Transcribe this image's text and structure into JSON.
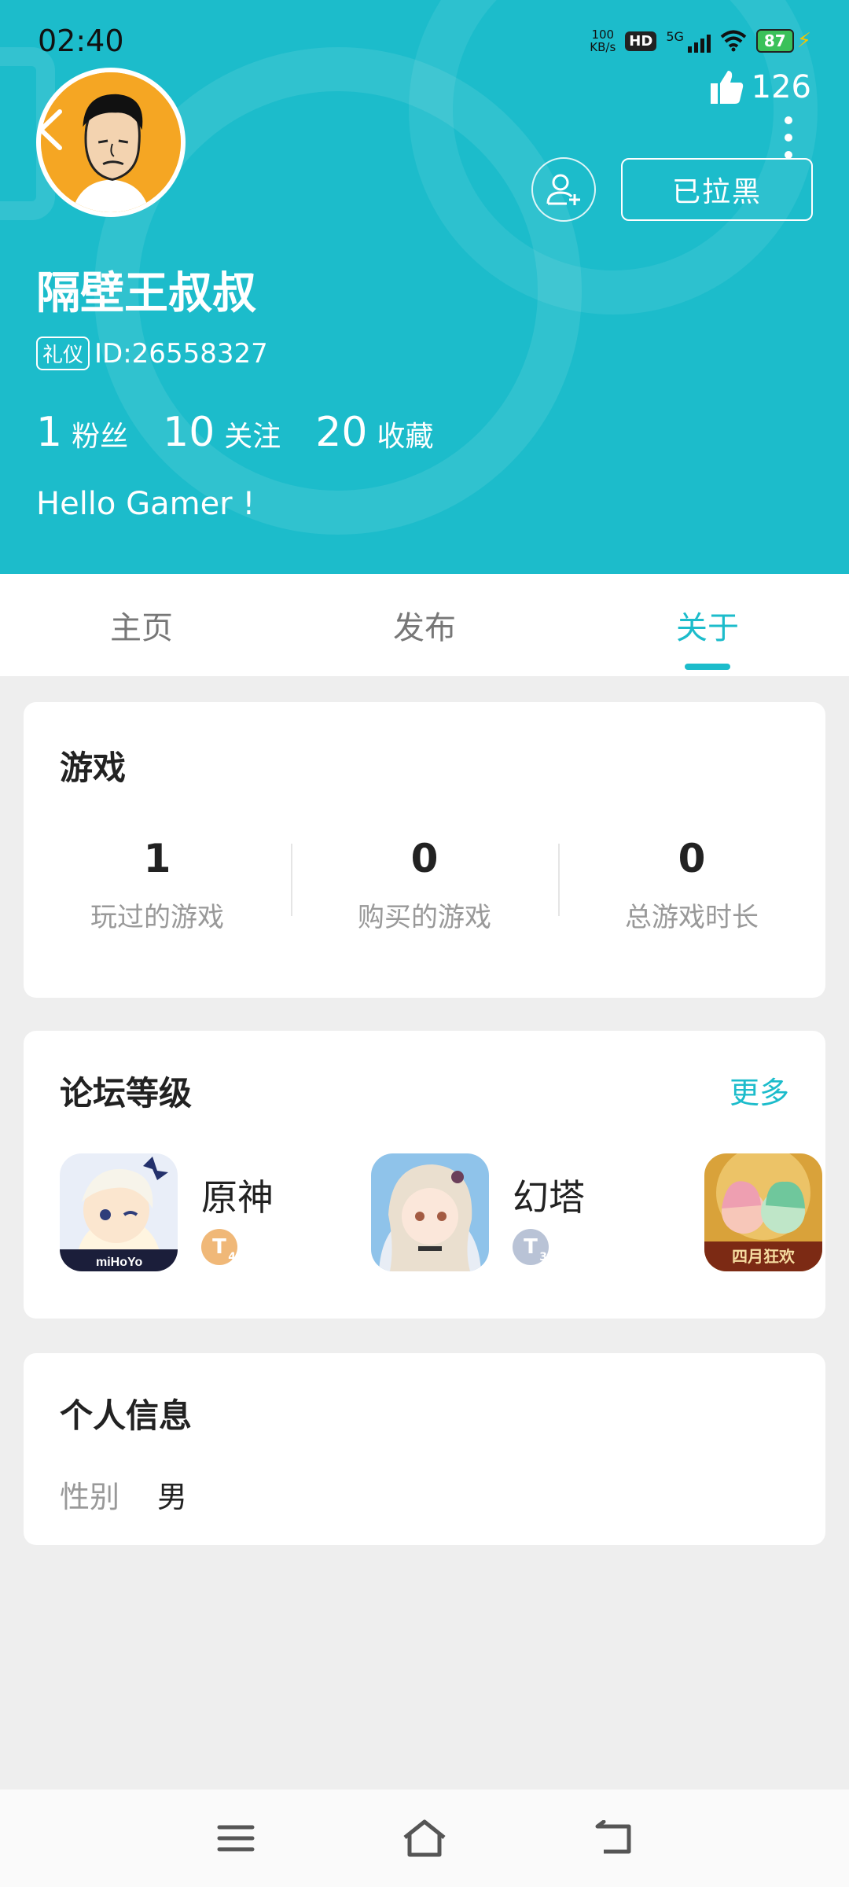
{
  "status_bar": {
    "time": "02:40",
    "net_speed_value": "100",
    "net_speed_unit": "KB/s",
    "hd": "HD",
    "network": "5G",
    "battery": "87"
  },
  "profile": {
    "likes": "126",
    "blocked_label": "已拉黑",
    "username": "隔壁王叔叔",
    "badge": "礼仪",
    "id_text": "ID:26558327",
    "fans_count": "1",
    "fans_label": "粉丝",
    "following_count": "10",
    "following_label": "关注",
    "favorites_count": "20",
    "favorites_label": "收藏",
    "bio": "Hello Gamer !"
  },
  "tabs": [
    {
      "label": "主页"
    },
    {
      "label": "发布"
    },
    {
      "label": "关于",
      "active": true
    }
  ],
  "games": {
    "title": "游戏",
    "stats": [
      {
        "value": "1",
        "label": "玩过的游戏"
      },
      {
        "value": "0",
        "label": "购买的游戏"
      },
      {
        "value": "0",
        "label": "总游戏时长"
      }
    ]
  },
  "forum": {
    "title": "论坛等级",
    "more": "更多",
    "items": [
      {
        "name": "原神",
        "level_letter": "T",
        "level_num": "4",
        "icon_brand": "miHoYo",
        "level_color": "#f0b878"
      },
      {
        "name": "幻塔",
        "level_letter": "T",
        "level_num": "3",
        "level_color": "#b9c3d6"
      },
      {
        "name": "",
        "banner": "四月狂欢",
        "level_color": "#d9d9d9"
      }
    ]
  },
  "personal_info": {
    "title": "个人信息",
    "gender_label": "性别",
    "gender_value": "男"
  },
  "colors": {
    "accent": "#1cbccb"
  }
}
